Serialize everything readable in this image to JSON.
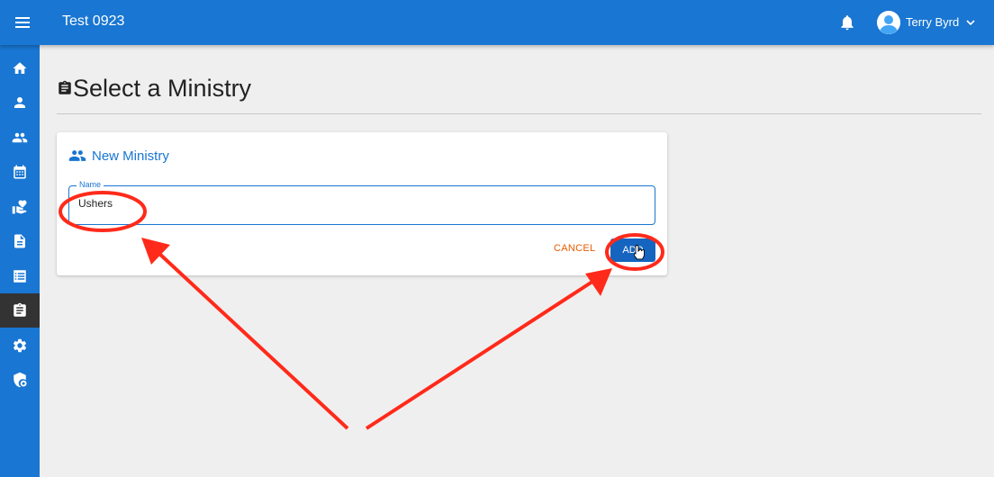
{
  "header": {
    "app_title": "Test 0923",
    "user_name": "Terry Byrd",
    "menu_icon": "hamburger-menu-icon",
    "notification_icon": "bell-icon",
    "avatar_icon": "account-circle-icon"
  },
  "sidebar": {
    "items": [
      {
        "icon": "home-icon",
        "active": false
      },
      {
        "icon": "person-icon",
        "active": false
      },
      {
        "icon": "people-icon",
        "active": false
      },
      {
        "icon": "calendar-icon",
        "active": false
      },
      {
        "icon": "donation-heart-icon",
        "active": false
      },
      {
        "icon": "document-icon",
        "active": false
      },
      {
        "icon": "list-icon",
        "active": false
      },
      {
        "icon": "clipboard-icon",
        "active": true
      },
      {
        "icon": "gear-icon",
        "active": false
      },
      {
        "icon": "security-shield-icon",
        "active": false
      }
    ]
  },
  "page": {
    "title": "Select a Ministry",
    "title_icon": "clipboard-icon"
  },
  "card": {
    "title": "New Ministry",
    "title_icon": "people-icon",
    "name_field": {
      "label": "Name",
      "value": "Ushers"
    },
    "cancel_label": "CANCEL",
    "add_label": "ADD"
  },
  "colors": {
    "primary": "#1976d2",
    "add_button": "#1565c0",
    "cancel_text": "#e65c00",
    "annotation": "#ff2a1a",
    "background": "#efefef"
  }
}
